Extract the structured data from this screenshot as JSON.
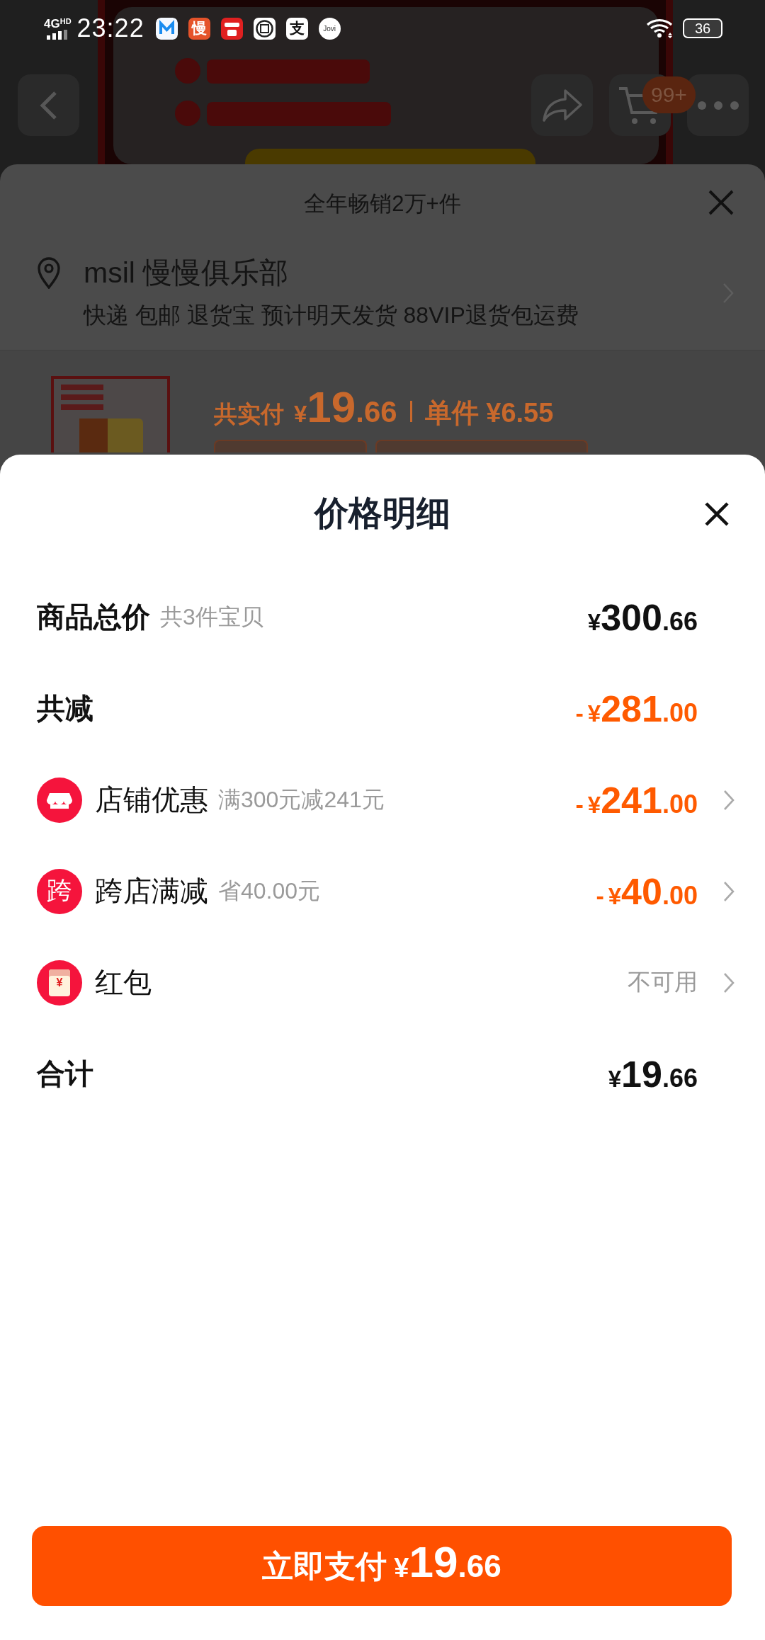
{
  "status_bar": {
    "network": "4G",
    "network_badge": "HD",
    "time": "23:22",
    "apps": [
      {
        "kind": "m"
      },
      {
        "kind": "glyph",
        "text": "慢",
        "color": "#e5532a"
      },
      {
        "kind": "pay",
        "color": "#e02020"
      },
      {
        "kind": "seal"
      },
      {
        "kind": "glyph",
        "text": "支",
        "color": "#ffffff"
      },
      {
        "kind": "round",
        "text": "Jovi",
        "color": "#ffffff"
      }
    ],
    "battery": "36"
  },
  "background": {
    "cart_badge": "99+",
    "sheet": {
      "title": "全年畅销2万+件",
      "address": {
        "name": "msil 慢慢俱乐部",
        "delivery": "快递 包邮 退货宝 预计明天发货 88VIP退货包运费"
      },
      "price": {
        "label": "共实付",
        "currency": "¥",
        "integer": "19",
        "decimal": ".66",
        "unit_label": "单件",
        "unit_price": "¥6.55"
      }
    }
  },
  "price_detail": {
    "title": "价格明细",
    "rows": [
      {
        "kind": "header",
        "label": "商品总价",
        "note": "共3件宝贝",
        "amount": {
          "currency": "¥",
          "integer": "300",
          "decimal": ".66"
        }
      },
      {
        "kind": "header",
        "label": "共减",
        "amount": {
          "sign": "-",
          "currency": "¥",
          "integer": "281",
          "decimal": ".00"
        }
      },
      {
        "kind": "shop",
        "label": "店铺优惠",
        "note": "满300元减241元",
        "amount": {
          "sign": "-",
          "currency": "¥",
          "integer": "241",
          "decimal": ".00"
        }
      },
      {
        "kind": "badge",
        "icon_text": "跨",
        "label": "跨店满减",
        "note": "省40.00元",
        "amount": {
          "sign": "-",
          "currency": "¥",
          "integer": "40",
          "decimal": ".00"
        }
      },
      {
        "kind": "envelope",
        "icon_text": "¥",
        "label": "红包",
        "status": "不可用"
      },
      {
        "kind": "header",
        "label": "合计",
        "amount": {
          "currency": "¥",
          "integer": "19",
          "decimal": ".66"
        }
      }
    ]
  },
  "pay_button": {
    "label": "立即支付",
    "currency": "¥",
    "integer": "19",
    "decimal": ".66"
  }
}
